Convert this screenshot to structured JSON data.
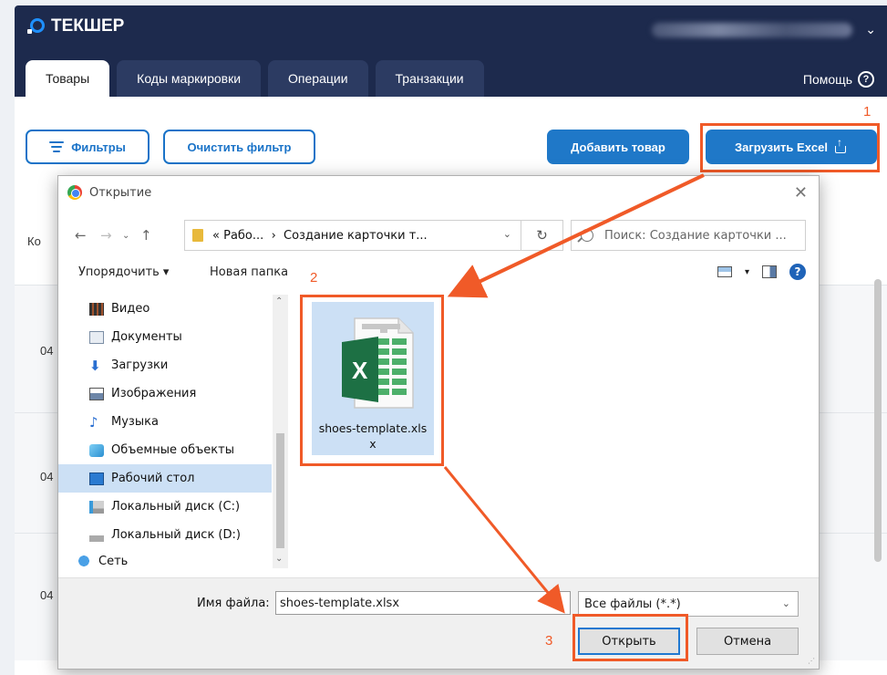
{
  "app": {
    "logo": "ТЕКШЕР",
    "tabs": [
      "Товары",
      "Коды маркировки",
      "Операции",
      "Транзакции"
    ],
    "help": "Помощь"
  },
  "toolbar": {
    "filters_label": "Фильтры",
    "clear_filter_label": "Очистить фильтр",
    "add_product_label": "Добавить товар",
    "upload_excel_label": "Загрузить Excel"
  },
  "table": {
    "header_fragment": "Ко",
    "row_codes": [
      "04",
      "04",
      "04"
    ]
  },
  "dialog": {
    "title": "Открытие",
    "address": {
      "prefix": "«",
      "crumb_1": "Рабо...",
      "separator": "›",
      "crumb_2": "Создание карточки т..."
    },
    "search_placeholder": "Поиск: Создание карточки ...",
    "organize_label": "Упорядочить ▾",
    "new_folder_label": "Новая папка",
    "sidebar_items": [
      "Видео",
      "Документы",
      "Загрузки",
      "Изображения",
      "Музыка",
      "Объемные объекты",
      "Рабочий стол",
      "Локальный диск (C:)",
      "Локальный диск (D:)",
      "Сеть"
    ],
    "file": {
      "name": "shoes-template.xlsx",
      "icon_letter": "X"
    },
    "filename_label": "Имя файла:",
    "filename_value": "shoes-template.xlsx",
    "filetype_value": "Все файлы (*.*)",
    "open_label": "Открыть",
    "cancel_label": "Отмена"
  },
  "annotations": {
    "step_1": "1",
    "step_2": "2",
    "step_3": "3",
    "color": "#f05a28"
  },
  "colors": {
    "header_bg": "#1d2a4d",
    "accent_blue": "#1f78c8",
    "selection": "#cce0f5",
    "excel_green": "#1d7044"
  }
}
